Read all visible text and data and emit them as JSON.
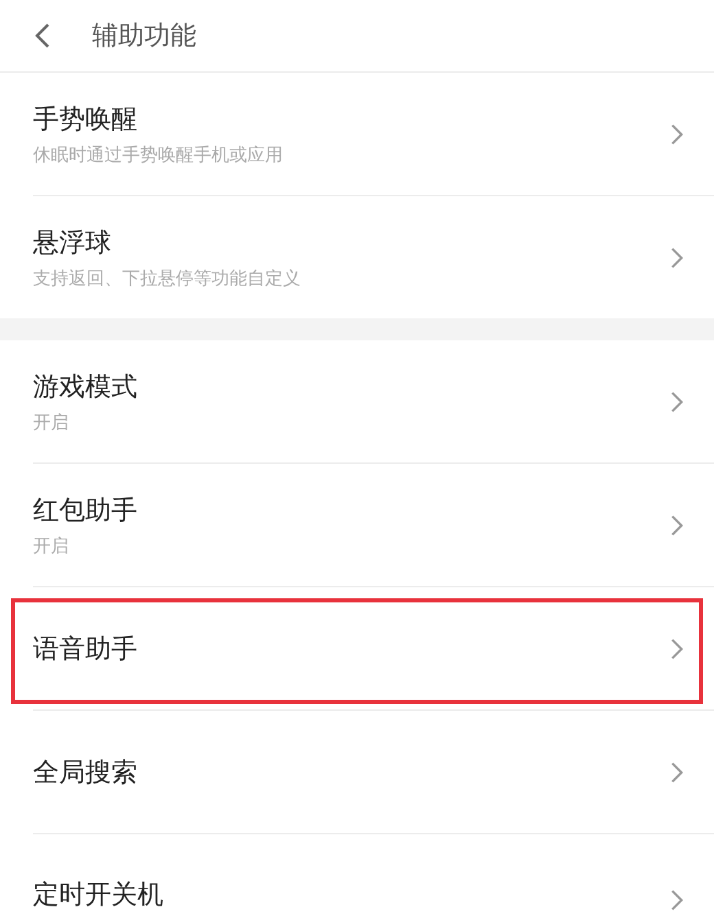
{
  "header": {
    "title": "辅助功能"
  },
  "groups": [
    {
      "items": [
        {
          "title": "手势唤醒",
          "subtitle": "休眠时通过手势唤醒手机或应用",
          "highlighted": false
        },
        {
          "title": "悬浮球",
          "subtitle": "支持返回、下拉悬停等功能自定义",
          "highlighted": false
        }
      ]
    },
    {
      "items": [
        {
          "title": "游戏模式",
          "subtitle": "开启",
          "highlighted": false
        },
        {
          "title": "红包助手",
          "subtitle": "开启",
          "highlighted": false
        },
        {
          "title": "语音助手",
          "highlighted": true
        },
        {
          "title": "全局搜索",
          "highlighted": false
        },
        {
          "title": "定时开关机",
          "highlighted": false
        }
      ]
    }
  ]
}
